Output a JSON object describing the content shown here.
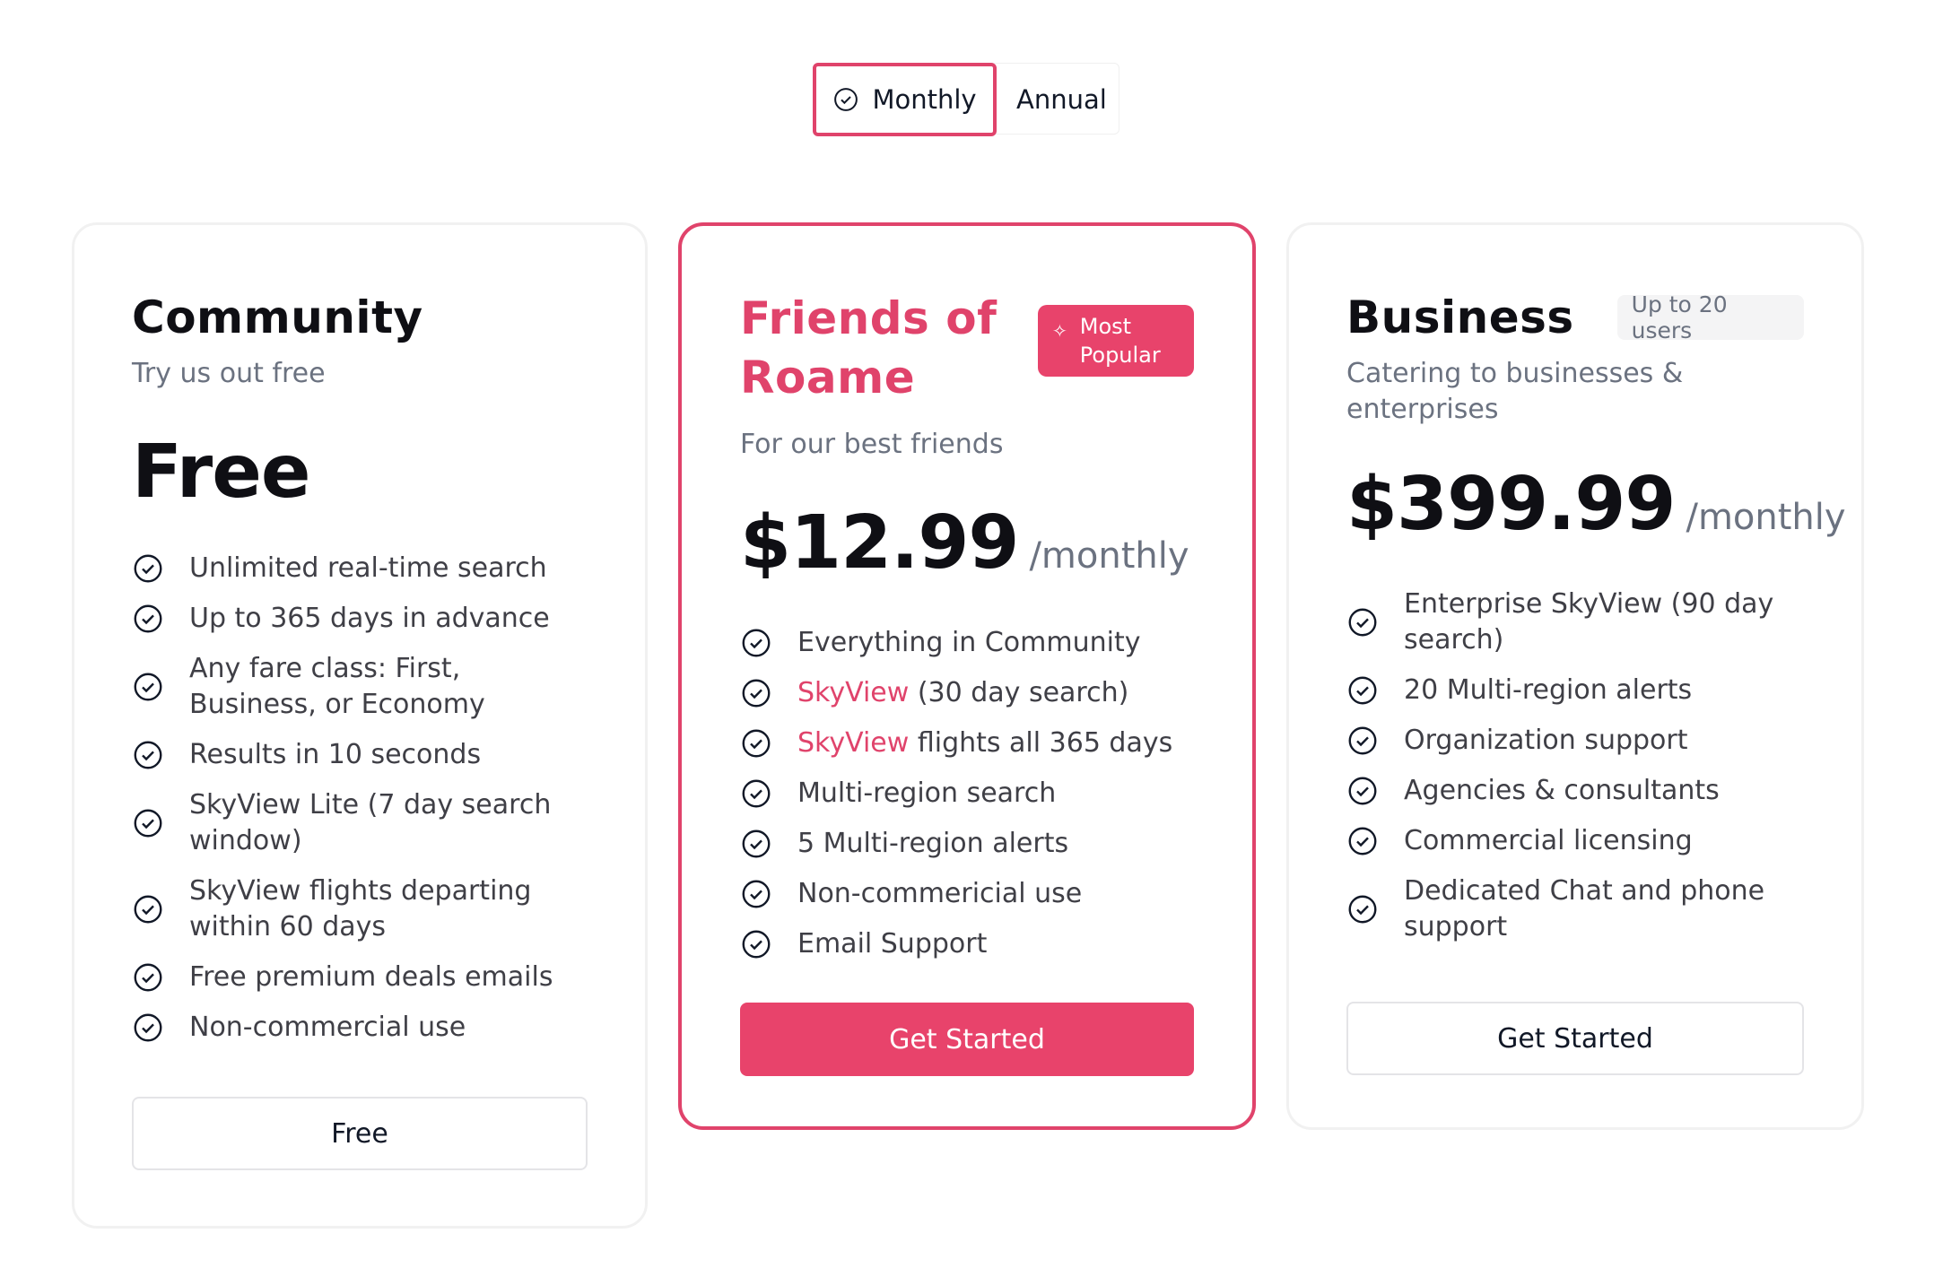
{
  "billing_toggle": {
    "monthly_label": "Monthly",
    "annual_label": "Annual",
    "selected": "Monthly"
  },
  "colors": {
    "accent": "#e0436b",
    "text_dark": "#0f0f14",
    "text_muted": "#6b7280",
    "border": "#f1f1f1"
  },
  "plans": [
    {
      "name": "Community",
      "subtitle": "Try us out free",
      "price": "Free",
      "period": "",
      "features": [
        "Unlimited real-time search",
        "Up to 365 days in advance",
        "Any fare class: First, Business, or Economy",
        "Results in 10 seconds",
        "SkyView Lite (7 day search window)",
        "SkyView flights departing within 60 days",
        "Free premium deals emails",
        "Non-commercial use"
      ],
      "button_label": "Free"
    },
    {
      "name": "Friends of Roame",
      "badge": "Most Popular",
      "badge_icon": "sparkle-icon",
      "subtitle": "For our best friends",
      "price": "$12.99",
      "period": "/monthly",
      "features": [
        {
          "highlight": "",
          "text": "Everything in Community"
        },
        {
          "highlight": "SkyView",
          "text": " (30 day search)"
        },
        {
          "highlight": "SkyView",
          "text": " flights all 365 days"
        },
        {
          "highlight": "",
          "text": "Multi-region search"
        },
        {
          "highlight": "",
          "text": "5 Multi-region alerts"
        },
        {
          "highlight": "",
          "text": "Non-commericial use"
        },
        {
          "highlight": "",
          "text": "Email Support"
        }
      ],
      "button_label": "Get Started"
    },
    {
      "name": "Business",
      "badge": "Up to 20 users",
      "subtitle": "Catering to businesses & enterprises",
      "price": "$399.99",
      "period": "/monthly",
      "features": [
        "Enterprise SkyView (90 day search)",
        "20 Multi-region alerts",
        "Organization support",
        "Agencies & consultants",
        "Commercial licensing",
        "Dedicated Chat and phone support"
      ],
      "button_label": "Get Started"
    }
  ]
}
